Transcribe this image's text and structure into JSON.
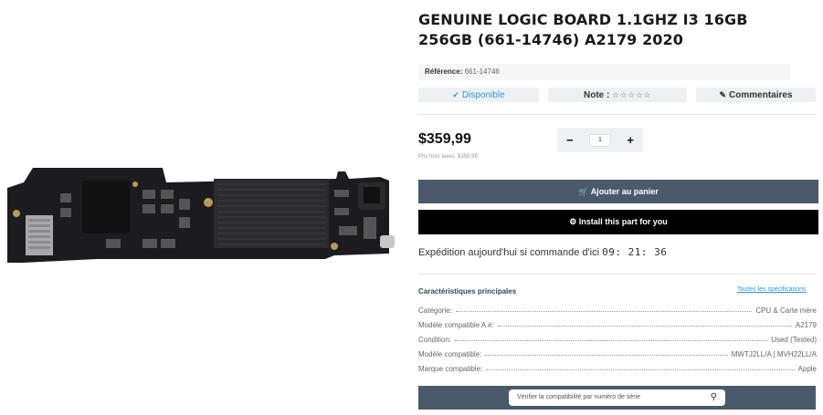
{
  "product": {
    "title": "GENUINE LOGIC BOARD 1.1GHZ I3 16GB 256GB (661-14746) A2179 2020",
    "reference_label": "Référence:",
    "reference_value": "661-14746"
  },
  "status": {
    "availability": "Disponible",
    "note_label": "Note :",
    "stars": "☆☆☆☆☆",
    "comments": "Commentaires"
  },
  "pricing": {
    "price": "$359,99",
    "price_ht": "Prix hors taxes: $359,99"
  },
  "quantity": {
    "minus": "−",
    "value": "1",
    "plus": "+"
  },
  "actions": {
    "add_to_cart": "Ajouter au panier",
    "install": "Install this part for you"
  },
  "shipping": {
    "text": "Expédition aujourd'hui si commande d'ici",
    "timer": "09: 21: 36"
  },
  "specs": {
    "title": "Caractéristiques principales",
    "all_link": "Toutes les spécifications",
    "rows": [
      {
        "key": "Catégorie:",
        "value": "CPU & Carte mère"
      },
      {
        "key": "Modèle compatible A #:",
        "value": "A2179"
      },
      {
        "key": "Condition:",
        "value": "Used (Tested)"
      },
      {
        "key": "Modèle compatible:",
        "value": "MWTJ2LL/A | MVH22LL/A"
      },
      {
        "key": "Marque compatible:",
        "value": "Apple"
      }
    ]
  },
  "verify": {
    "placeholder": "Vérifier la compatibilité par numéro de série"
  },
  "icons": {
    "availability": "check-circle-icon",
    "comments": "pencil-icon",
    "cart": "basket-icon",
    "install": "gear-icon",
    "search": "search-icon"
  },
  "colors": {
    "accent_blue": "#2f9ad6",
    "button_slate": "#4a5a6a",
    "install_black": "#000000"
  }
}
